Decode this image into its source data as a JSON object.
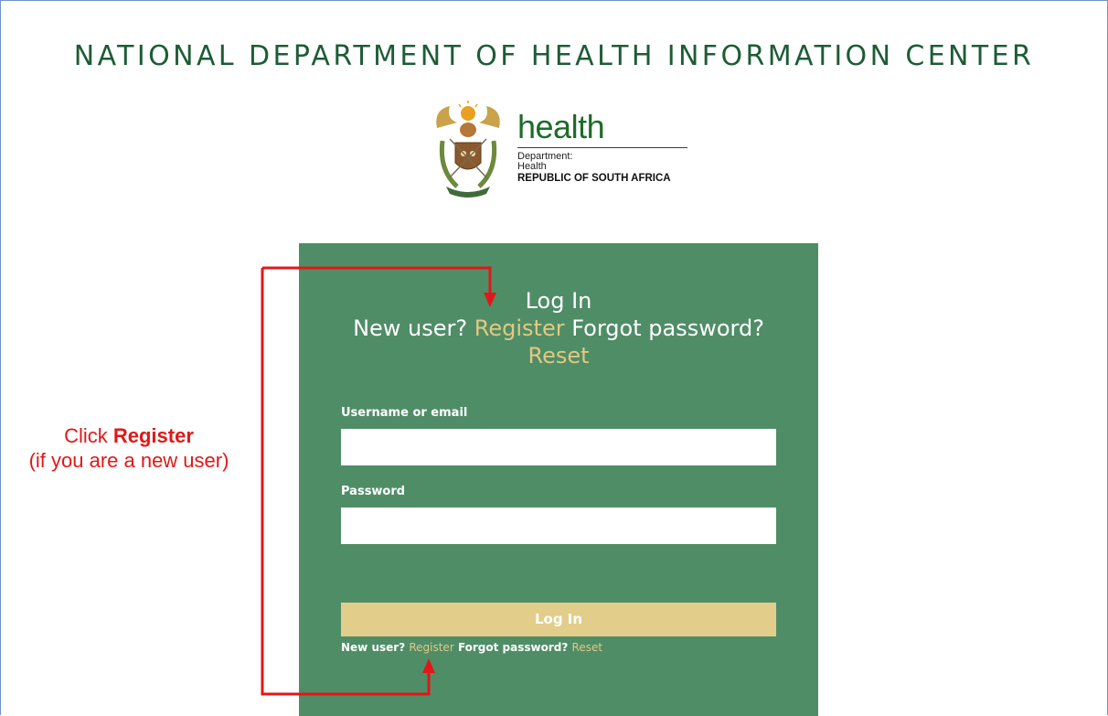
{
  "page": {
    "site_title": "NATIONAL DEPARTMENT OF HEALTH INFORMATION CENTER"
  },
  "logo": {
    "word": "health",
    "line1": "Department:",
    "line2": "Health",
    "line3": "REPUBLIC OF SOUTH AFRICA",
    "crest_icon": "south-africa-coat-of-arms-icon"
  },
  "login": {
    "heading": "Log In",
    "new_user_text": "New user?",
    "register_link": "Register",
    "forgot_text": "Forgot password?",
    "reset_link": "Reset",
    "username_label": "Username or email",
    "username_value": "",
    "password_label": "Password",
    "password_value": "",
    "submit_label": "Log In",
    "bottom_new_user": "New user?",
    "bottom_register": "Register",
    "bottom_forgot": "Forgot password?",
    "bottom_reset": "Reset"
  },
  "annotation": {
    "prefix": "Click ",
    "emphasis": "Register",
    "note": "(if you are a  new user)",
    "color": "#e01818"
  },
  "colors": {
    "panel": "#4f8d67",
    "link_gold": "#e2c882",
    "button": "#e3cd8a",
    "title_green": "#1d5c36"
  }
}
